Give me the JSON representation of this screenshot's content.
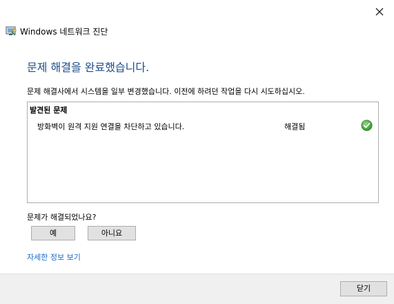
{
  "window": {
    "app_title": "Windows 네트워크 진단",
    "close_icon": "close-icon",
    "app_icon": "network-diagnostics-icon"
  },
  "main": {
    "heading": "문제 해결을 완료했습니다.",
    "description": "문제 해결사에서 시스템을 일부 변경했습니다. 이전에 하려던 작업을 다시 시도하십시오.",
    "problems": {
      "title": "발견된 문제",
      "items": [
        {
          "text": "방화벽이 원격 지원 연결을 차단하고 있습니다.",
          "status": "해결됨",
          "status_icon": "check-success-icon"
        }
      ]
    },
    "question": "문제가 해결되었나요?",
    "yes_label": "예",
    "no_label": "아니요",
    "details_link": "자세한 정보 보기"
  },
  "footer": {
    "close_label": "닫기"
  },
  "colors": {
    "heading": "#1b4d8c",
    "link": "#1b6ac9",
    "success": "#3aa13a",
    "footer_bg": "#f0f0f0"
  }
}
